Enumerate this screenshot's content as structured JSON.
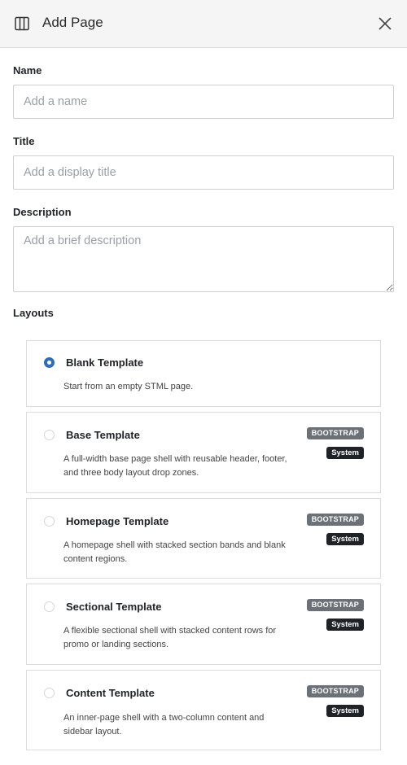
{
  "header": {
    "title": "Add Page",
    "left_icon": "side-panel-icon",
    "close_icon": "close-icon"
  },
  "form": {
    "name": {
      "label": "Name",
      "placeholder": "Add a name",
      "value": ""
    },
    "title": {
      "label": "Title",
      "placeholder": "Add a display title",
      "value": ""
    },
    "description": {
      "label": "Description",
      "placeholder": "Add a brief description",
      "value": ""
    }
  },
  "layouts": {
    "label": "Layouts",
    "items": [
      {
        "title": "Blank Template",
        "description": "Start from an empty STML page.",
        "selected": true
      },
      {
        "title": "Base Template",
        "description": "A full-width base page shell with reusable header, footer, and three body layout drop zones.",
        "badge": "BOOTSTRAP",
        "tag": "System",
        "selected": false
      },
      {
        "title": "Homepage Template",
        "description": "A homepage shell with stacked section bands and blank content regions.",
        "badge": "BOOTSTRAP",
        "tag": "System",
        "selected": false
      },
      {
        "title": "Sectional Template",
        "description": "A flexible sectional shell with stacked content rows for promo or landing sections.",
        "badge": "BOOTSTRAP",
        "tag": "System",
        "selected": false
      },
      {
        "title": "Content Template",
        "description": "An inner-page shell with a two-column content and sidebar layout.",
        "badge": "BOOTSTRAP",
        "tag": "System",
        "selected": false
      }
    ]
  },
  "colors": {
    "header_bg": "#f5f5f5",
    "radio_selected": "#2f6db5",
    "badge_bootstrap": "#6b7177",
    "badge_system": "#1f2328"
  }
}
